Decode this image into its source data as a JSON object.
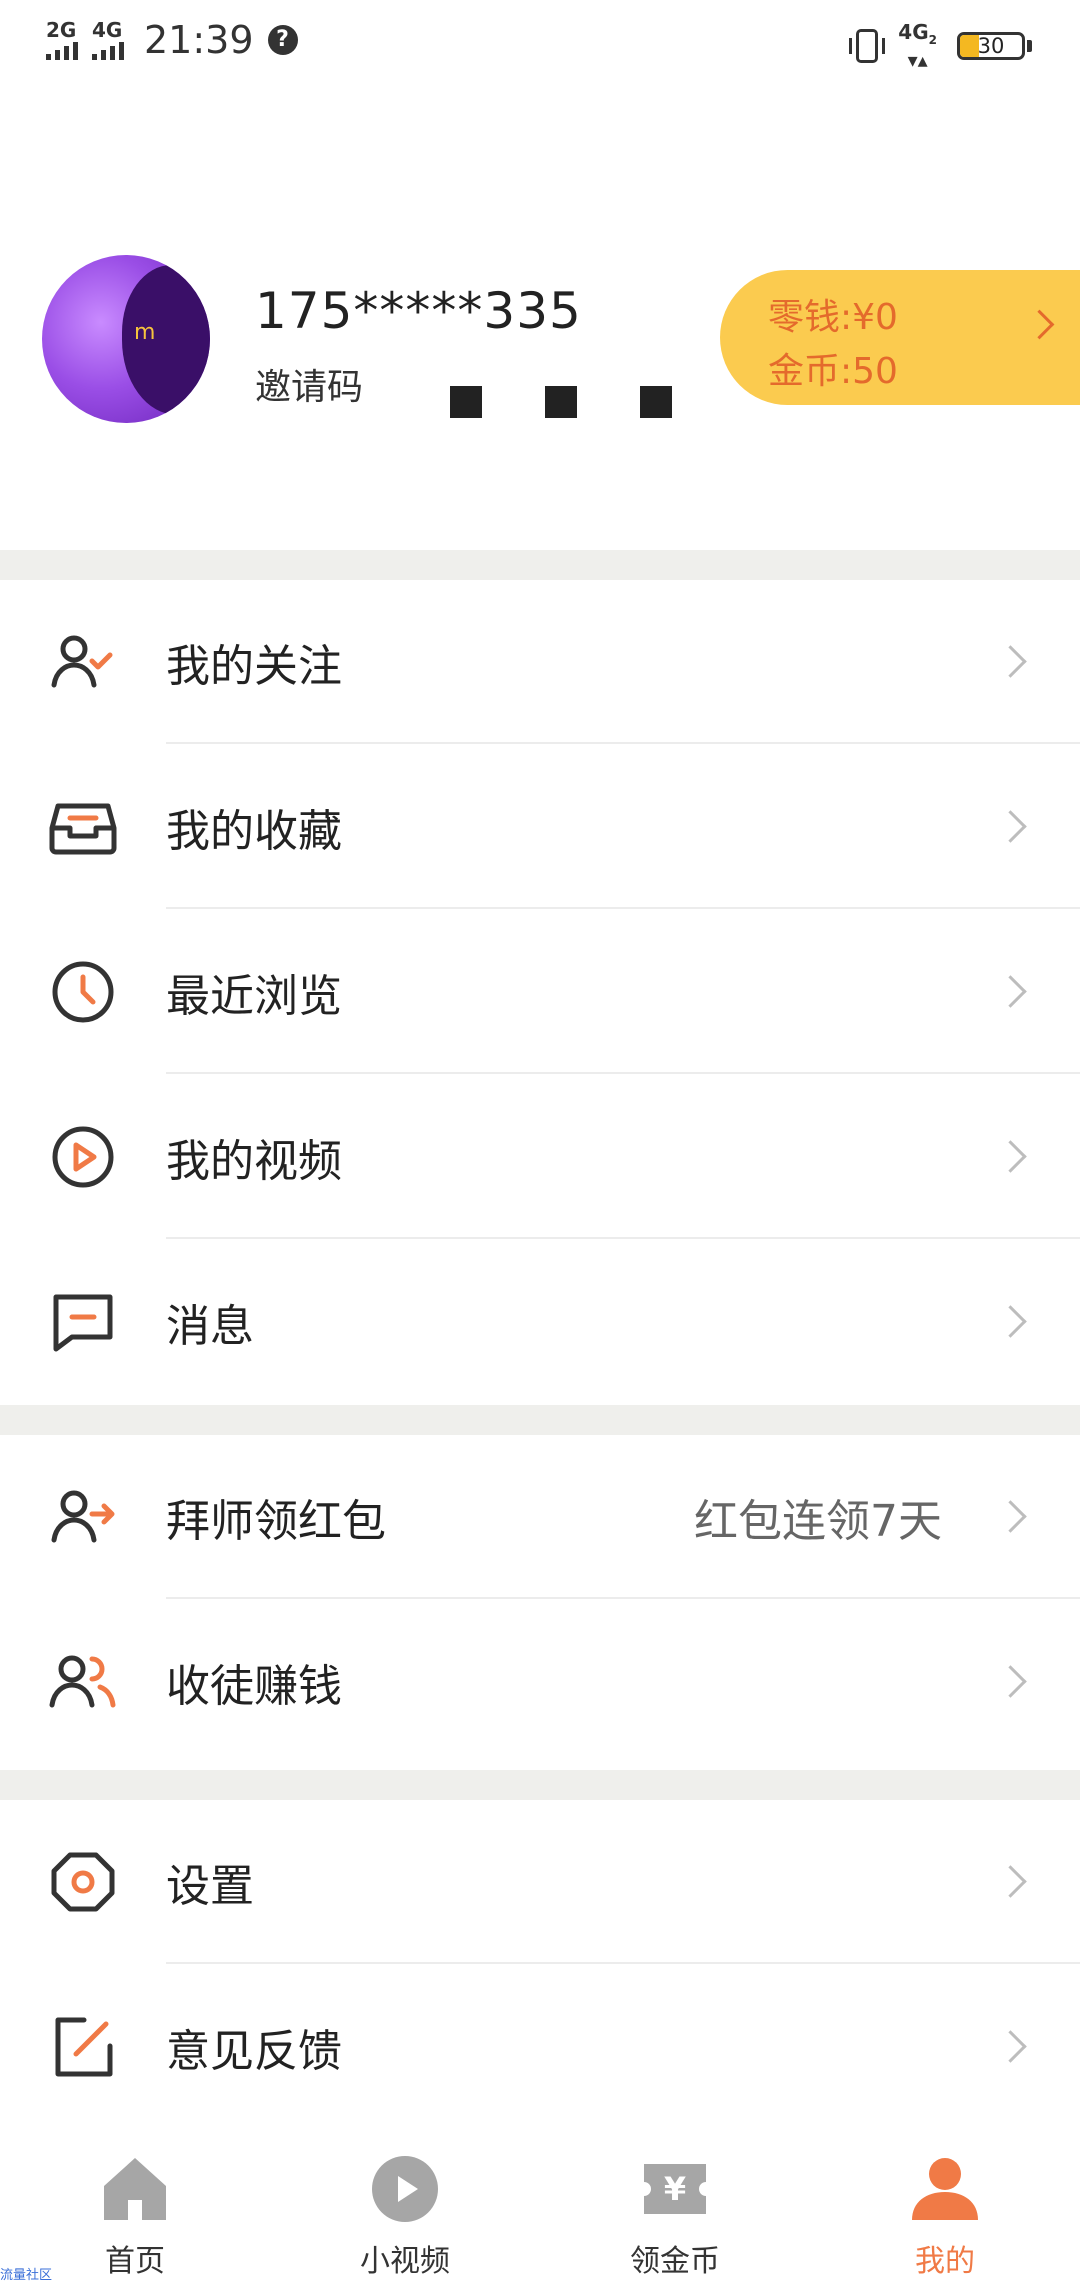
{
  "status_bar": {
    "signal1": "2G",
    "signal2": "4G",
    "time": "21:39",
    "network": "4G",
    "network_sub": "2",
    "battery_percent": 30,
    "battery_label": "30"
  },
  "profile": {
    "phone_masked": "175*****335",
    "invite_label": "邀请码",
    "wallet": {
      "change_label": "零钱:¥0",
      "coins_label": "金币:50"
    }
  },
  "menu_sections": [
    [
      {
        "label": "我的关注",
        "icon": "user-check-icon"
      },
      {
        "label": "我的收藏",
        "icon": "inbox-icon"
      },
      {
        "label": "最近浏览",
        "icon": "clock-icon"
      },
      {
        "label": "我的视频",
        "icon": "play-circle-icon"
      },
      {
        "label": "消息",
        "icon": "message-icon"
      }
    ],
    [
      {
        "label": "拜师领红包",
        "icon": "user-arrow-icon",
        "extra": "红包连领7天"
      },
      {
        "label": "收徒赚钱",
        "icon": "users-icon"
      }
    ],
    [
      {
        "label": "设置",
        "icon": "settings-icon"
      },
      {
        "label": "意见反馈",
        "icon": "edit-icon"
      }
    ]
  ],
  "bottom_nav": [
    {
      "label": "首页",
      "icon": "home-icon"
    },
    {
      "label": "小视频",
      "icon": "play-icon"
    },
    {
      "label": "领金币",
      "icon": "coupon-icon"
    },
    {
      "label": "我的",
      "icon": "person-icon",
      "active": true
    }
  ],
  "colors": {
    "accent": "#f07a46",
    "wallet_bg": "#fbcb4f",
    "icon_dark": "#333333",
    "divider": "#efefec"
  },
  "watermark": "流量社区"
}
